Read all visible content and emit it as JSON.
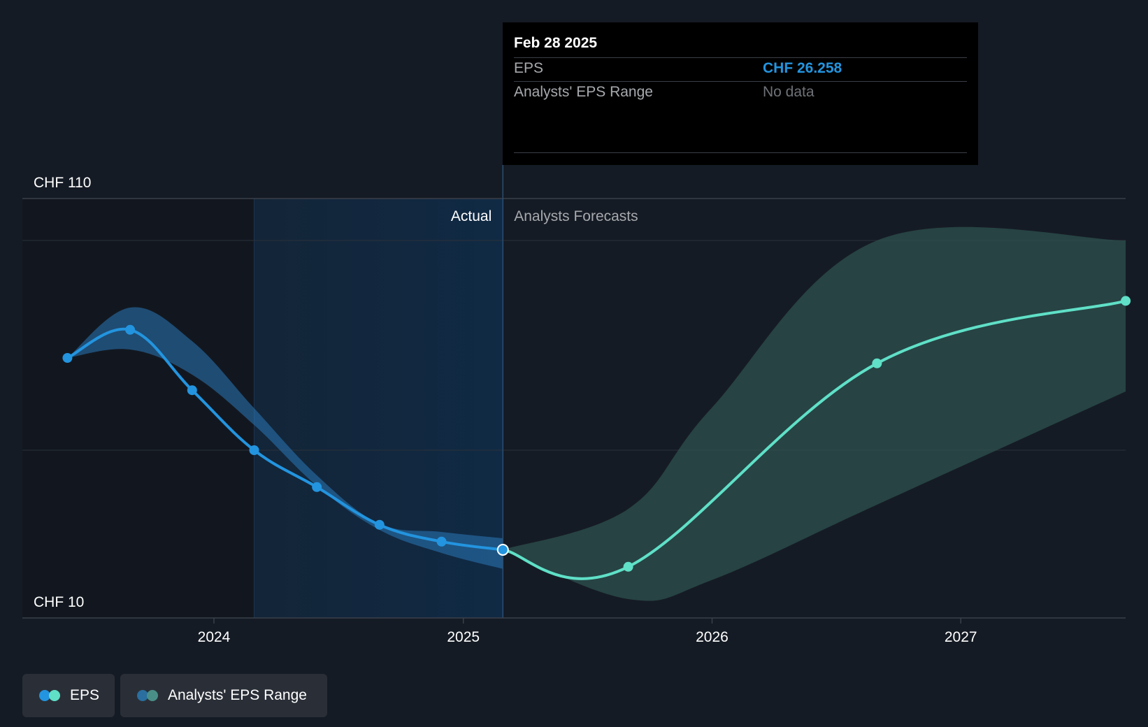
{
  "chart_data": {
    "type": "line",
    "y_axis": {
      "unit": "CHF",
      "ylim": [
        10,
        110
      ],
      "tick_labels": [
        "CHF 110",
        "CHF 10"
      ]
    },
    "x_axis": {
      "tick_labels": [
        "2024",
        "2025",
        "2026",
        "2027"
      ]
    },
    "sections": {
      "actual_label": "Actual",
      "forecast_label": "Analysts Forecasts",
      "divider_date": "2025-02-28"
    },
    "series": [
      {
        "name": "EPS",
        "kind": "actual",
        "color": "#2394df",
        "points": [
          {
            "x": "2023-05-31",
            "y": 72.0
          },
          {
            "x": "2023-08-31",
            "y": 78.7
          },
          {
            "x": "2023-11-30",
            "y": 64.3
          },
          {
            "x": "2024-02-29",
            "y": 50.0
          },
          {
            "x": "2024-05-31",
            "y": 41.2
          },
          {
            "x": "2024-08-31",
            "y": 32.2
          },
          {
            "x": "2024-11-30",
            "y": 28.2
          },
          {
            "x": "2025-02-28",
            "y": 26.258
          }
        ]
      },
      {
        "name": "EPS",
        "kind": "forecast",
        "color": "#5fe0c7",
        "points": [
          {
            "x": "2025-02-28",
            "y": 26.258
          },
          {
            "x": "2025-08-31",
            "y": 22.2
          },
          {
            "x": "2026-08-31",
            "y": 70.7
          },
          {
            "x": "2027-08-31",
            "y": 85.6
          }
        ]
      }
    ],
    "ranges": [
      {
        "name": "Analysts' EPS Range",
        "kind": "actual",
        "color": "#2a78b8",
        "x": [
          "2023-05-31",
          "2023-08-31",
          "2023-11-30",
          "2024-02-29",
          "2024-05-31",
          "2024-08-31",
          "2024-11-30",
          "2025-02-28"
        ],
        "high": [
          72.0,
          84.0,
          76.0,
          60.0,
          44.0,
          32.5,
          30.5,
          29.0
        ],
        "low": [
          72.0,
          74.0,
          68.0,
          56.0,
          41.5,
          31.0,
          25.5,
          21.7
        ]
      },
      {
        "name": "Analysts' EPS Range",
        "kind": "forecast",
        "color": "#2e514f",
        "x": [
          "2025-02-28",
          "2025-08-31",
          "2025-12-31",
          "2026-08-31",
          "2027-08-31"
        ],
        "high": [
          26.258,
          36.0,
          60.0,
          100.0,
          100.0
        ],
        "low": [
          26.258,
          14.5,
          19.0,
          37.0,
          64.0
        ]
      }
    ]
  },
  "tooltip": {
    "date": "Feb 28 2025",
    "rows": [
      {
        "label": "EPS",
        "value": "CHF 26.258",
        "color": "#2394df"
      },
      {
        "label": "Analysts' EPS Range",
        "value": "No data",
        "color": "#6e7277"
      }
    ]
  },
  "legend": [
    {
      "label": "EPS",
      "dot_colors": [
        "#2394df",
        "#5fe0c7"
      ]
    },
    {
      "label": "Analysts' EPS Range",
      "dot_colors": [
        "#2a6f9f",
        "#4a8f87"
      ]
    }
  ]
}
